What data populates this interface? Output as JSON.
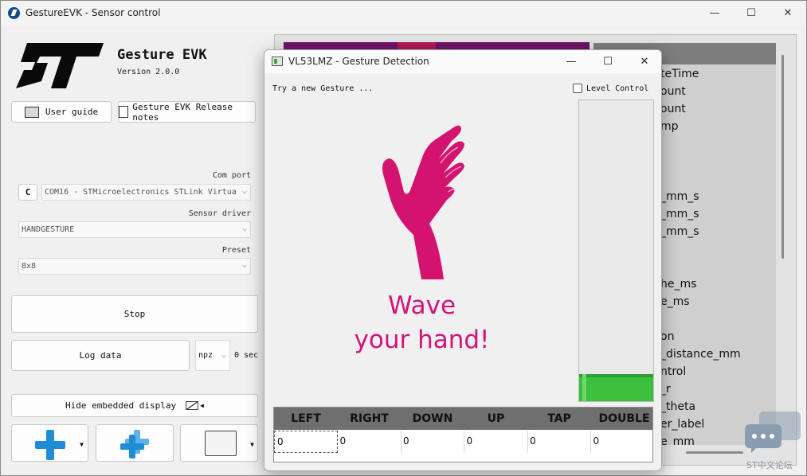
{
  "window": {
    "title": "GestureEVK - Sensor control",
    "minimize": "—",
    "maximize": "☐",
    "close": "✕"
  },
  "brand": {
    "title": "Gesture EVK",
    "version": "Version 2.0.0"
  },
  "links": {
    "user_guide": "User guide",
    "release_notes": "Gesture EVK Release notes"
  },
  "com_port": {
    "label": "Com port",
    "value": "COM16 - STMicroelectronics STLink Virtua",
    "refresh": "C"
  },
  "sensor_driver": {
    "label": "Sensor driver",
    "value": "HANDGESTURE"
  },
  "preset": {
    "label": "Preset",
    "value": "8x8"
  },
  "actions": {
    "stop": "Stop",
    "log_data": "Log data",
    "format": "npz",
    "duration": "0 sec",
    "hide_display": "Hide embedded display"
  },
  "right_list": {
    "items": [
      "teTime",
      "ount",
      "ount",
      "mp",
      "_mm_s",
      "_mm_s",
      "_mm_s",
      "he_ms",
      "e_ms",
      "on",
      "_distance_mm",
      "ntrol",
      "_r",
      "_theta",
      "er_label",
      "e_mm"
    ]
  },
  "watermark": "ST中文论坛",
  "dialog": {
    "title": "VL53LMZ - Gesture Detection",
    "minimize": "—",
    "maximize": "☐",
    "close": "✕",
    "prompt": "Try a new Gesture ...",
    "level_control_label": "Level Control",
    "level_value_percent": 9,
    "wave_line1": "Wave",
    "wave_line2": "your hand!",
    "table": {
      "headers": [
        "LEFT",
        "RIGHT",
        "DOWN",
        "UP",
        "TAP",
        "DOUBLE"
      ],
      "values": [
        "0",
        "0",
        "0",
        "0",
        "0",
        "0"
      ]
    }
  },
  "colors": {
    "accent_magenta": "#d4137a",
    "level_green": "#3cbf3c",
    "plus_blue": "#1f8dd6"
  }
}
